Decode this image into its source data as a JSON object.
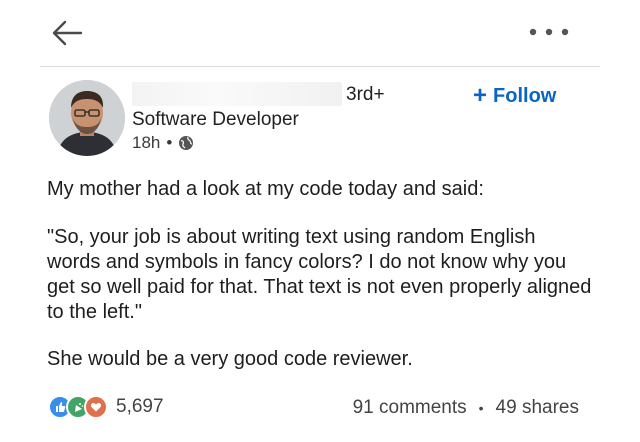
{
  "header": {
    "back_icon": "arrow-left-icon",
    "more_icon": "ellipsis-icon"
  },
  "author": {
    "degree": "3rd+",
    "headline": "Software Developer",
    "time": "18h",
    "time_separator": "•",
    "visibility_icon": "globe-icon",
    "follow_label": "Follow",
    "follow_icon": "+"
  },
  "post": {
    "paragraph1": "My mother had a look at my code today and said:",
    "paragraph2": "\"So, your job is about writing text using random English words and symbols in fancy colors? I do not know why you get so well paid for that. That text is not even properly aligned to the left.\"",
    "paragraph3": "She would be a very good code reviewer."
  },
  "social": {
    "reaction_icons": [
      "like-icon",
      "celebrate-icon",
      "love-icon"
    ],
    "reaction_count": "5,697",
    "comments": "91 comments",
    "separator": "•",
    "shares": "49 shares"
  },
  "colors": {
    "accent": "#0a66c2",
    "like": "#378fe9",
    "celebrate": "#44a367",
    "love": "#df704d"
  }
}
